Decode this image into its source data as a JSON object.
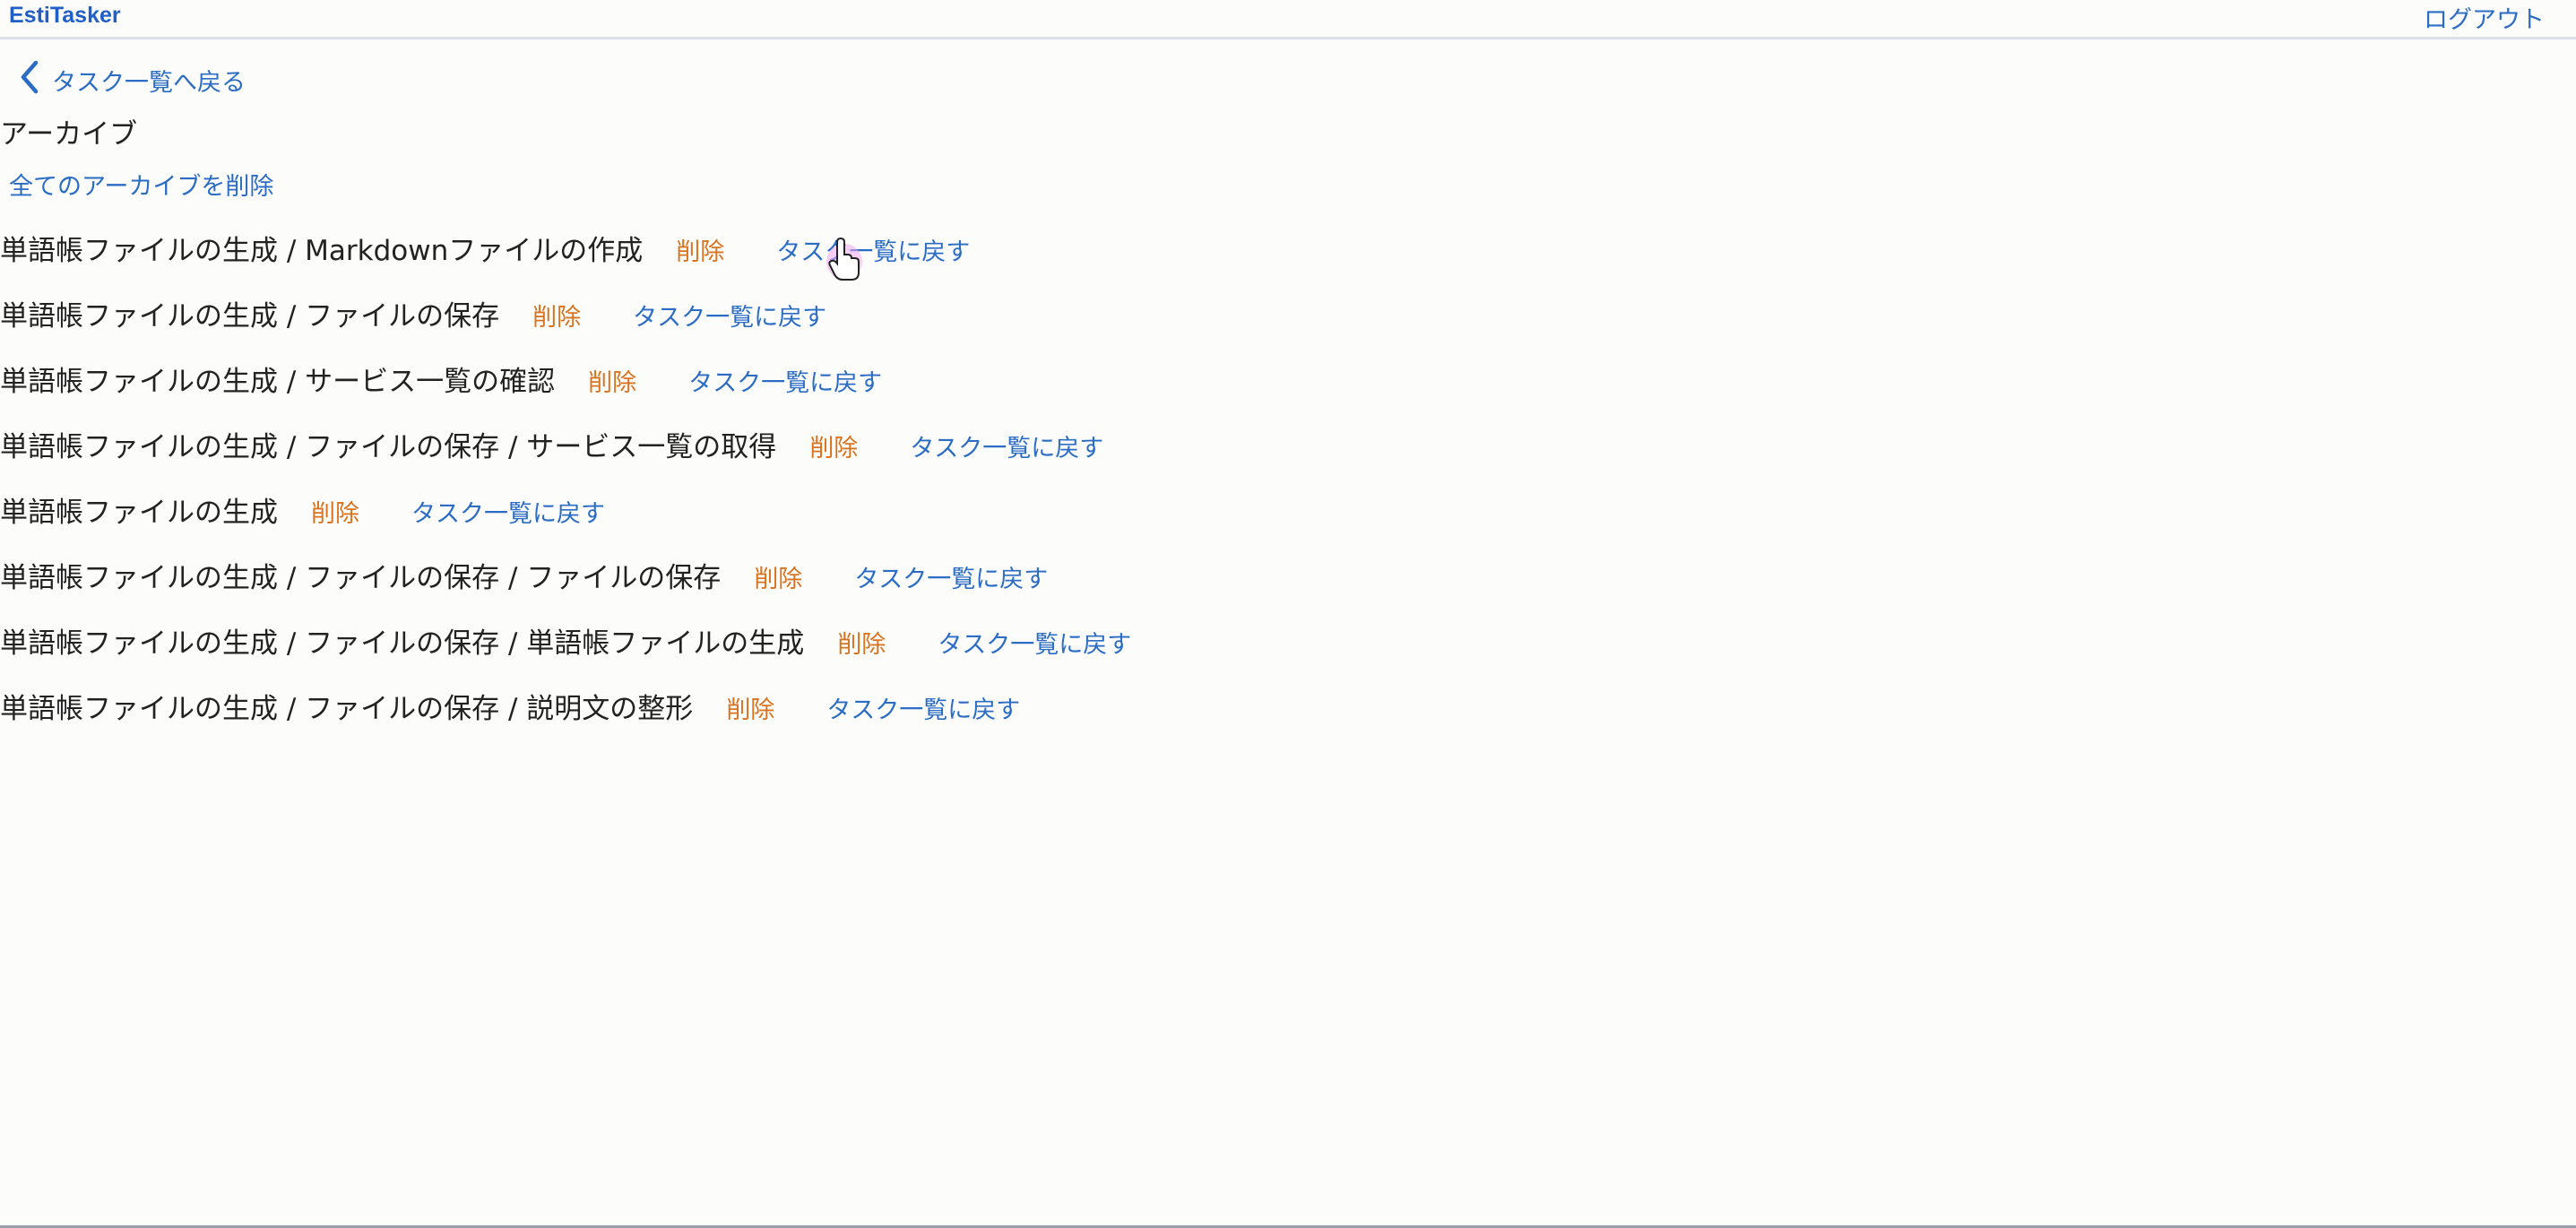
{
  "header": {
    "brand": "EstiTasker",
    "logout": "ログアウト"
  },
  "nav": {
    "back_label": "タスク一覧へ戻る",
    "back_icon": "chevron-left-icon"
  },
  "page": {
    "title": "アーカイブ",
    "delete_all_label": "全てのアーカイブを削除"
  },
  "tasks": [
    {
      "title": "単語帳ファイルの生成 / Markdownファイルの作成",
      "delete_label": "削除",
      "restore_label": "タスク一覧に戻す"
    },
    {
      "title": "単語帳ファイルの生成 / ファイルの保存",
      "delete_label": "削除",
      "restore_label": "タスク一覧に戻す"
    },
    {
      "title": "単語帳ファイルの生成 / サービス一覧の確認",
      "delete_label": "削除",
      "restore_label": "タスク一覧に戻す"
    },
    {
      "title": "単語帳ファイルの生成 / ファイルの保存 / サービス一覧の取得",
      "delete_label": "削除",
      "restore_label": "タスク一覧に戻す"
    },
    {
      "title": "単語帳ファイルの生成",
      "delete_label": "削除",
      "restore_label": "タスク一覧に戻す"
    },
    {
      "title": "単語帳ファイルの生成 / ファイルの保存 / ファイルの保存",
      "delete_label": "削除",
      "restore_label": "タスク一覧に戻す"
    },
    {
      "title": "単語帳ファイルの生成 / ファイルの保存 / 単語帳ファイルの生成",
      "delete_label": "削除",
      "restore_label": "タスク一覧に戻す"
    },
    {
      "title": "単語帳ファイルの生成 / ファイルの保存 / 説明文の整形",
      "delete_label": "削除",
      "restore_label": "タスク一覧に戻す"
    }
  ],
  "colors": {
    "link": "#2b6cc4",
    "delete": "#d9731f",
    "text": "#222222",
    "brand": "#1f5fc6",
    "background": "#fcfcfb"
  }
}
